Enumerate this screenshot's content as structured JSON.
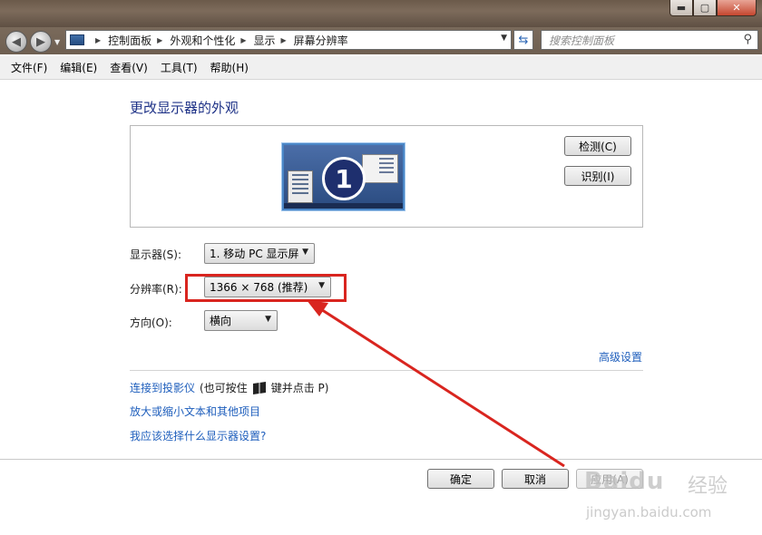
{
  "window": {
    "controls": {
      "minimize": "▬",
      "maximize": "▢",
      "close": "✕"
    }
  },
  "nav": {
    "back_icon": "arrow-left-icon",
    "forward_icon": "arrow-right-icon",
    "breadcrumb": [
      "控制面板",
      "外观和个性化",
      "显示",
      "屏幕分辨率"
    ],
    "search_placeholder": "搜索控制面板"
  },
  "menu": [
    "文件(F)",
    "编辑(E)",
    "查看(V)",
    "工具(T)",
    "帮助(H)"
  ],
  "main": {
    "heading": "更改显示器的外观",
    "monitor_number": "1",
    "detect_label": "检测(C)",
    "identify_label": "识别(I)",
    "display_label": "显示器(S):",
    "display_value": "1. 移动 PC 显示屏",
    "resolution_label": "分辨率(R):",
    "resolution_value": "1366 × 768 (推荐)",
    "orientation_label": "方向(O):",
    "orientation_value": "横向",
    "advanced_link": "高级设置",
    "projector_link": "连接到投影仪",
    "projector_suffix_pre": "(也可按住",
    "projector_suffix_post": "键并点击 P)",
    "text_size_link": "放大或缩小文本和其他项目",
    "which_settings_link": "我应该选择什么显示器设置?"
  },
  "footer": {
    "ok_label": "确定",
    "cancel_label": "取消",
    "apply_label": "应用(A)"
  },
  "watermark": {
    "logo": "Baidu",
    "text": "经验",
    "url": "jingyan.baidu.com"
  },
  "colors": {
    "highlight": "#d9251f",
    "link": "#1e5ebc",
    "heading": "#1e3287"
  }
}
